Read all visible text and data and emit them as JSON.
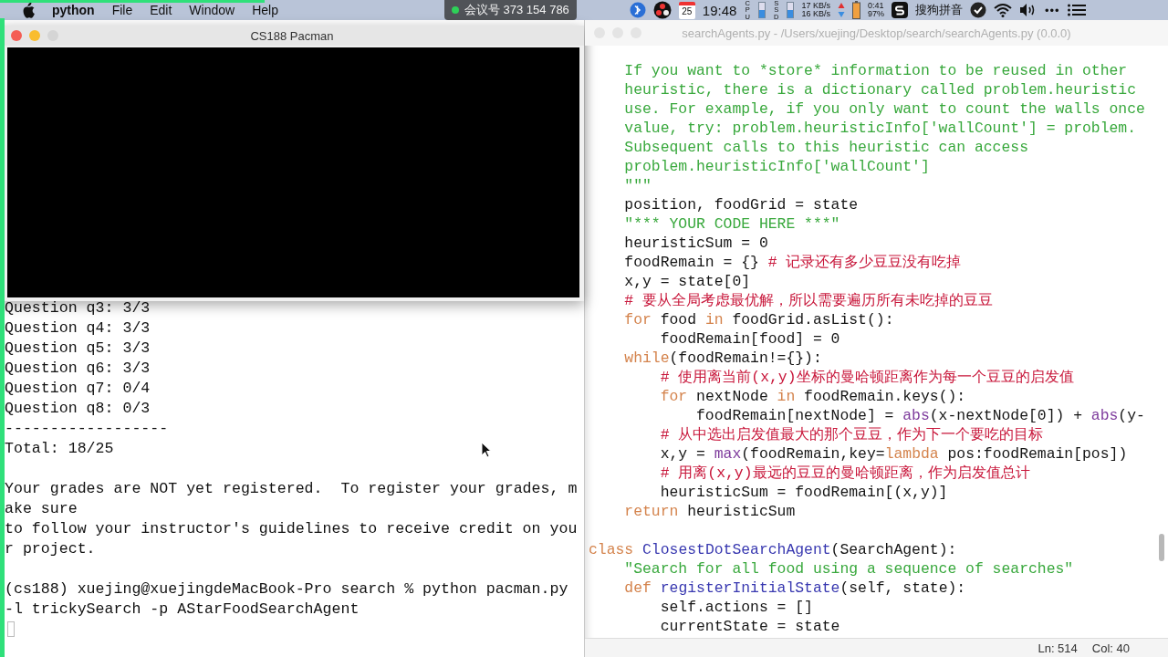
{
  "menu_bar": {
    "app": "python",
    "menus": [
      "File",
      "Edit",
      "Window",
      "Help"
    ],
    "meeting": "会议号 373 154 786",
    "calendar_day": "25",
    "clock": "19:48",
    "cpu_label": "CPU",
    "ssd_label": "SSD",
    "net_up": "17 KB/s",
    "net_down": "16 KB/s",
    "battery_time": "0:41",
    "battery_percent": "97%",
    "input_method": "搜狗拼音",
    "more": "•••"
  },
  "pacman_window": {
    "title": "CS188 Pacman"
  },
  "terminal": {
    "blocks": [
      [
        "Question q3: 3/3",
        "Question q4: 3/3",
        "Question q5: 3/3",
        "Question q6: 3/3",
        "Question q7: 0/4",
        "Question q8: 0/3",
        "------------------",
        "Total: 18/25"
      ],
      [
        "Your grades are NOT yet registered.  To register your grades, m",
        "ake sure",
        "to follow your instructor's guidelines to receive credit on you",
        "r project."
      ],
      [
        "(cs188) xuejing@xuejingdeMacBook-Pro search % python pacman.py",
        "-l trickySearch -p AStarFoodSearchAgent"
      ]
    ]
  },
  "editor": {
    "title": "searchAgents.py - /Users/xuejing/Desktop/search/searchAgents.py (0.0.0)",
    "blocks": [
      [
        [
          {
            "kind": "string",
            "text": "    If you want to *store* information to be reused in other"
          }
        ],
        [
          {
            "kind": "string",
            "text": "    heuristic, there is a dictionary called problem.heuristic"
          }
        ],
        [
          {
            "kind": "string",
            "text": "    use. For example, if you only want to count the walls once"
          }
        ],
        [
          {
            "kind": "string",
            "text": "    value, try: problem.heuristicInfo['wallCount'] = problem."
          }
        ],
        [
          {
            "kind": "string",
            "text": "    Subsequent calls to this heuristic can access"
          }
        ],
        [
          {
            "kind": "string",
            "text": "    problem.heuristicInfo['wallCount']"
          }
        ],
        [
          {
            "kind": "string",
            "text": "    \"\"\""
          }
        ],
        [
          {
            "kind": "code",
            "text": "    position, foodGrid = state"
          }
        ],
        [
          {
            "kind": "string",
            "text": "    \"*** YOUR CODE HERE ***\""
          }
        ],
        [
          {
            "kind": "code",
            "text": "    heuristicSum = 0"
          }
        ],
        [
          {
            "kind": "code",
            "text": "    foodRemain = {} "
          },
          {
            "kind": "comment",
            "text": "# 记录还有多少豆豆没有吃掉"
          }
        ],
        [
          {
            "kind": "code",
            "text": "    x,y = state[0]"
          }
        ],
        [
          {
            "kind": "comment",
            "text": "    # 要从全局考虑最优解，所以需要遍历所有未吃掉的豆豆"
          }
        ],
        [
          {
            "kind": "keyword",
            "text": "    for"
          },
          {
            "kind": "code",
            "text": " food "
          },
          {
            "kind": "keyword",
            "text": "in"
          },
          {
            "kind": "code",
            "text": " foodGrid.asList():"
          }
        ],
        [
          {
            "kind": "code",
            "text": "        foodRemain[food] = 0"
          }
        ],
        [
          {
            "kind": "keyword",
            "text": "    while"
          },
          {
            "kind": "code",
            "text": "(foodRemain!={}):"
          }
        ],
        [
          {
            "kind": "comment",
            "text": "        # 使用离当前(x,y)坐标的曼哈顿距离作为每一个豆豆的启发值"
          }
        ],
        [
          {
            "kind": "keyword",
            "text": "        for"
          },
          {
            "kind": "code",
            "text": " nextNode "
          },
          {
            "kind": "keyword",
            "text": "in"
          },
          {
            "kind": "code",
            "text": " foodRemain.keys():"
          }
        ],
        [
          {
            "kind": "code",
            "text": "            foodRemain[nextNode] = "
          },
          {
            "kind": "builtin",
            "text": "abs"
          },
          {
            "kind": "code",
            "text": "(x-nextNode[0]) + "
          },
          {
            "kind": "builtin",
            "text": "abs"
          },
          {
            "kind": "code",
            "text": "(y-"
          }
        ],
        [
          {
            "kind": "comment",
            "text": "        # 从中选出启发值最大的那个豆豆，作为下一个要吃的目标"
          }
        ],
        [
          {
            "kind": "code",
            "text": "        x,y = "
          },
          {
            "kind": "builtin",
            "text": "max"
          },
          {
            "kind": "code",
            "text": "(foodRemain,key="
          },
          {
            "kind": "keyword",
            "text": "lambda"
          },
          {
            "kind": "code",
            "text": " pos:foodRemain[pos])"
          }
        ],
        [
          {
            "kind": "comment",
            "text": "        # 用离(x,y)最远的豆豆的曼哈顿距离，作为启发值总计"
          }
        ],
        [
          {
            "kind": "code",
            "text": "        heuristicSum = foodRemain[(x,y)]"
          }
        ],
        [
          {
            "kind": "keyword",
            "text": "    return"
          },
          {
            "kind": "code",
            "text": " heuristicSum"
          }
        ]
      ],
      [
        [
          {
            "kind": "keyword",
            "text": "class "
          },
          {
            "kind": "name",
            "text": "ClosestDotSearchAgent"
          },
          {
            "kind": "code",
            "text": "(SearchAgent):"
          }
        ],
        [
          {
            "kind": "string",
            "text": "    \"Search for all food using a sequence of searches\""
          }
        ],
        [
          {
            "kind": "keyword",
            "text": "    def "
          },
          {
            "kind": "name",
            "text": "registerInitialState"
          },
          {
            "kind": "code",
            "text": "(self, state):"
          }
        ],
        [
          {
            "kind": "code",
            "text": "        self.actions = []"
          }
        ],
        [
          {
            "kind": "code",
            "text": "        currentState = state"
          }
        ]
      ]
    ],
    "status": {
      "line": "Ln: 514",
      "column": "Col: 40"
    }
  }
}
